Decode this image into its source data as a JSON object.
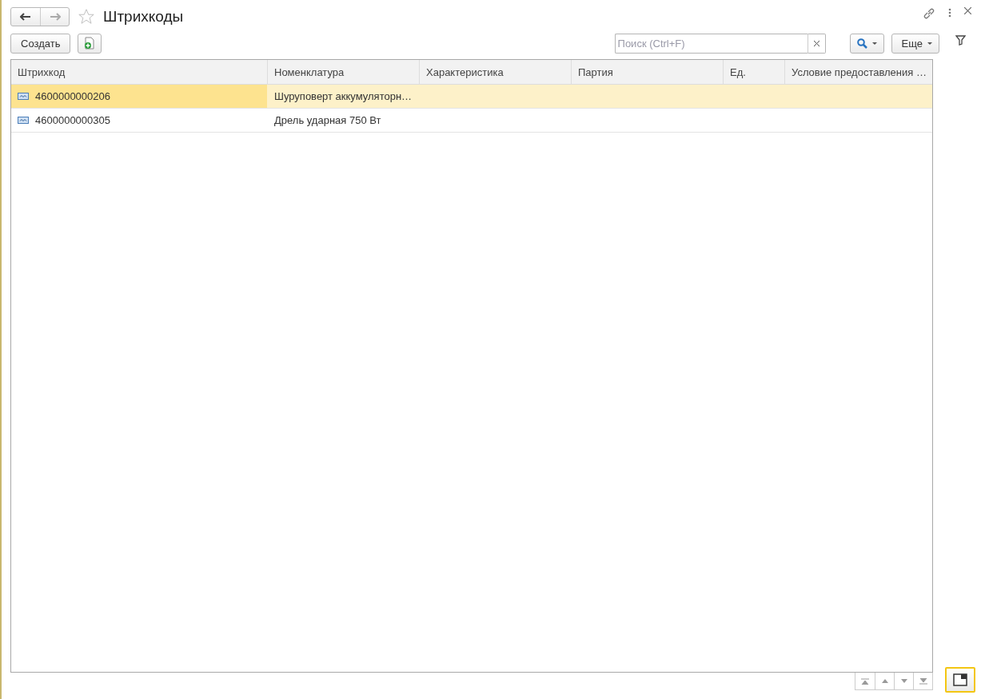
{
  "window": {
    "title": "Штрихкоды",
    "favorite": false
  },
  "toolbar": {
    "create_button": "Создать",
    "search": {
      "placeholder": "Поиск (Ctrl+F)"
    },
    "more_button": "Еще"
  },
  "table": {
    "columns": [
      "Штрихкод",
      "Номенклатура",
      "Характеристика",
      "Партия",
      "Ед.",
      "Условие предоставления …"
    ],
    "rows": [
      {
        "selected": true,
        "cells": [
          "4600000000206",
          "Шуруповерт аккумуляторн…",
          "",
          "",
          "",
          ""
        ]
      },
      {
        "selected": false,
        "cells": [
          "4600000000305",
          "Дрель ударная 750 Вт",
          "",
          "",
          "",
          ""
        ]
      }
    ]
  }
}
